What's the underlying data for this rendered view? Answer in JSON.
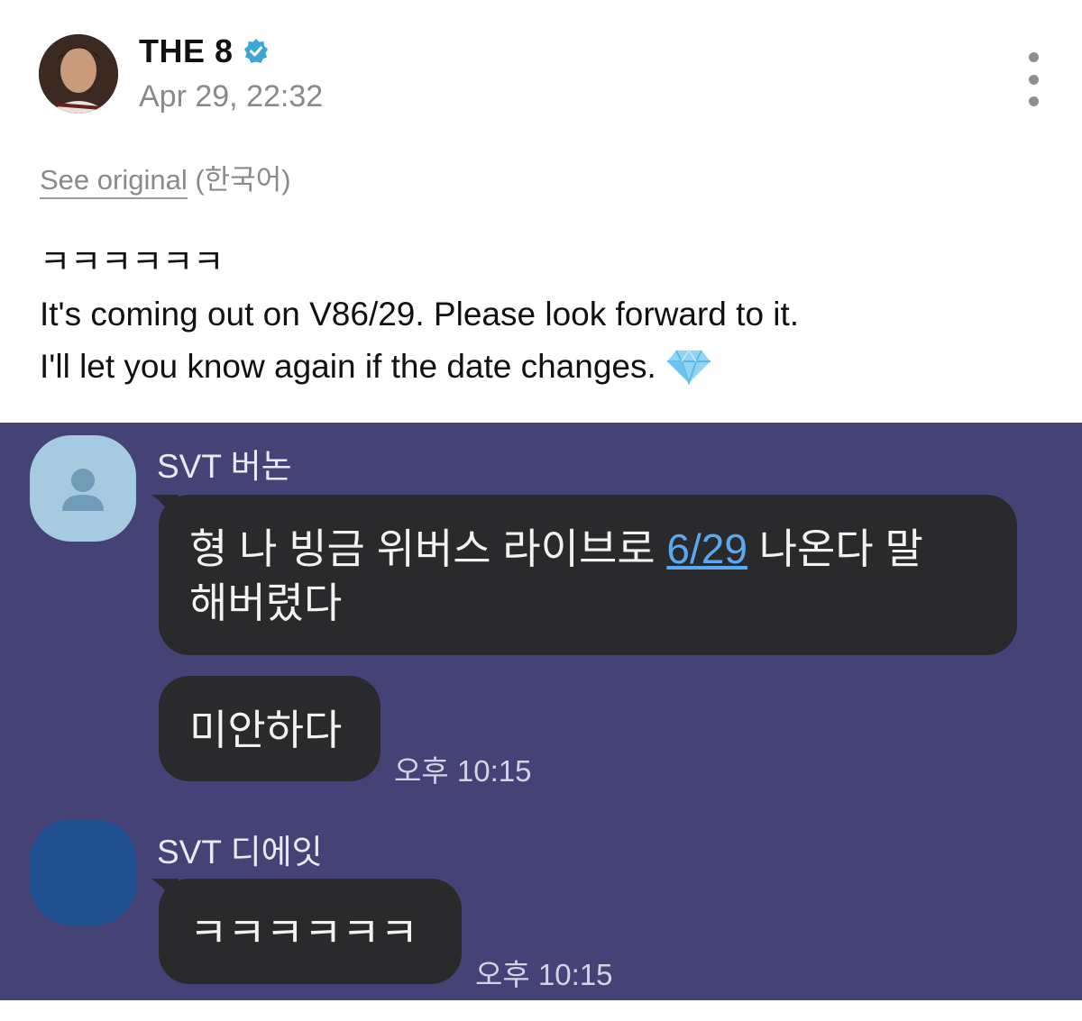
{
  "author": {
    "name": "THE 8",
    "verified_icon": "verified-badge-icon",
    "verified_color": "#3aa7d6"
  },
  "post": {
    "time": "Apr 29, 22:32",
    "see_original": "See original",
    "original_language": "(한국어)",
    "lines": [
      "ㅋㅋㅋㅋㅋㅋ",
      "It's coming out on V86/29. Please look forward to it.",
      "I'll let you know again if the date changes."
    ],
    "emoji": "gem-icon"
  },
  "chat": {
    "background": "#454275",
    "bubble_color": "#2a2a2c",
    "messages": [
      {
        "sender": "SVT 버논",
        "text_before": "형 나 빙금 위버스 라이브로 ",
        "link": "6/29",
        "text_after": " 나온다 말",
        "text_line2": "해버렸다"
      },
      {
        "text": "미안하다",
        "time": "오후 10:15"
      },
      {
        "sender": "SVT 디에잇",
        "text": "ㅋㅋㅋㅋㅋㅋ",
        "time": "오후 10:15"
      }
    ]
  }
}
